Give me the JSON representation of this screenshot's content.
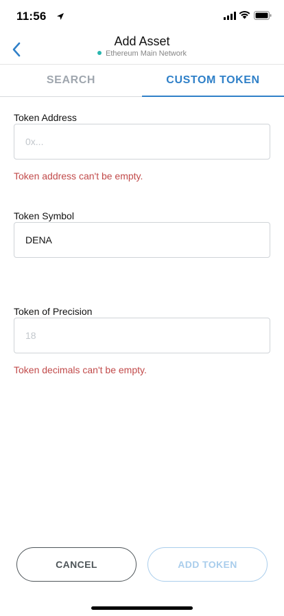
{
  "status_bar": {
    "time": "11:56"
  },
  "header": {
    "title": "Add Asset",
    "network": "Ethereum Main Network"
  },
  "tabs": [
    {
      "label": "SEARCH",
      "active": false
    },
    {
      "label": "CUSTOM TOKEN",
      "active": true
    }
  ],
  "form": {
    "address": {
      "label": "Token Address",
      "value": "",
      "placeholder": "0x...",
      "error": "Token address can't be empty."
    },
    "symbol": {
      "label": "Token Symbol",
      "value": "DENA",
      "placeholder": ""
    },
    "precision": {
      "label": "Token of Precision",
      "value": "",
      "placeholder": "18",
      "error": "Token decimals can't be empty."
    }
  },
  "footer": {
    "cancel_label": "CANCEL",
    "add_label": "ADD TOKEN"
  },
  "colors": {
    "accent": "#2f80c8",
    "error": "#c14a4a",
    "network_dot": "#29b6af"
  }
}
